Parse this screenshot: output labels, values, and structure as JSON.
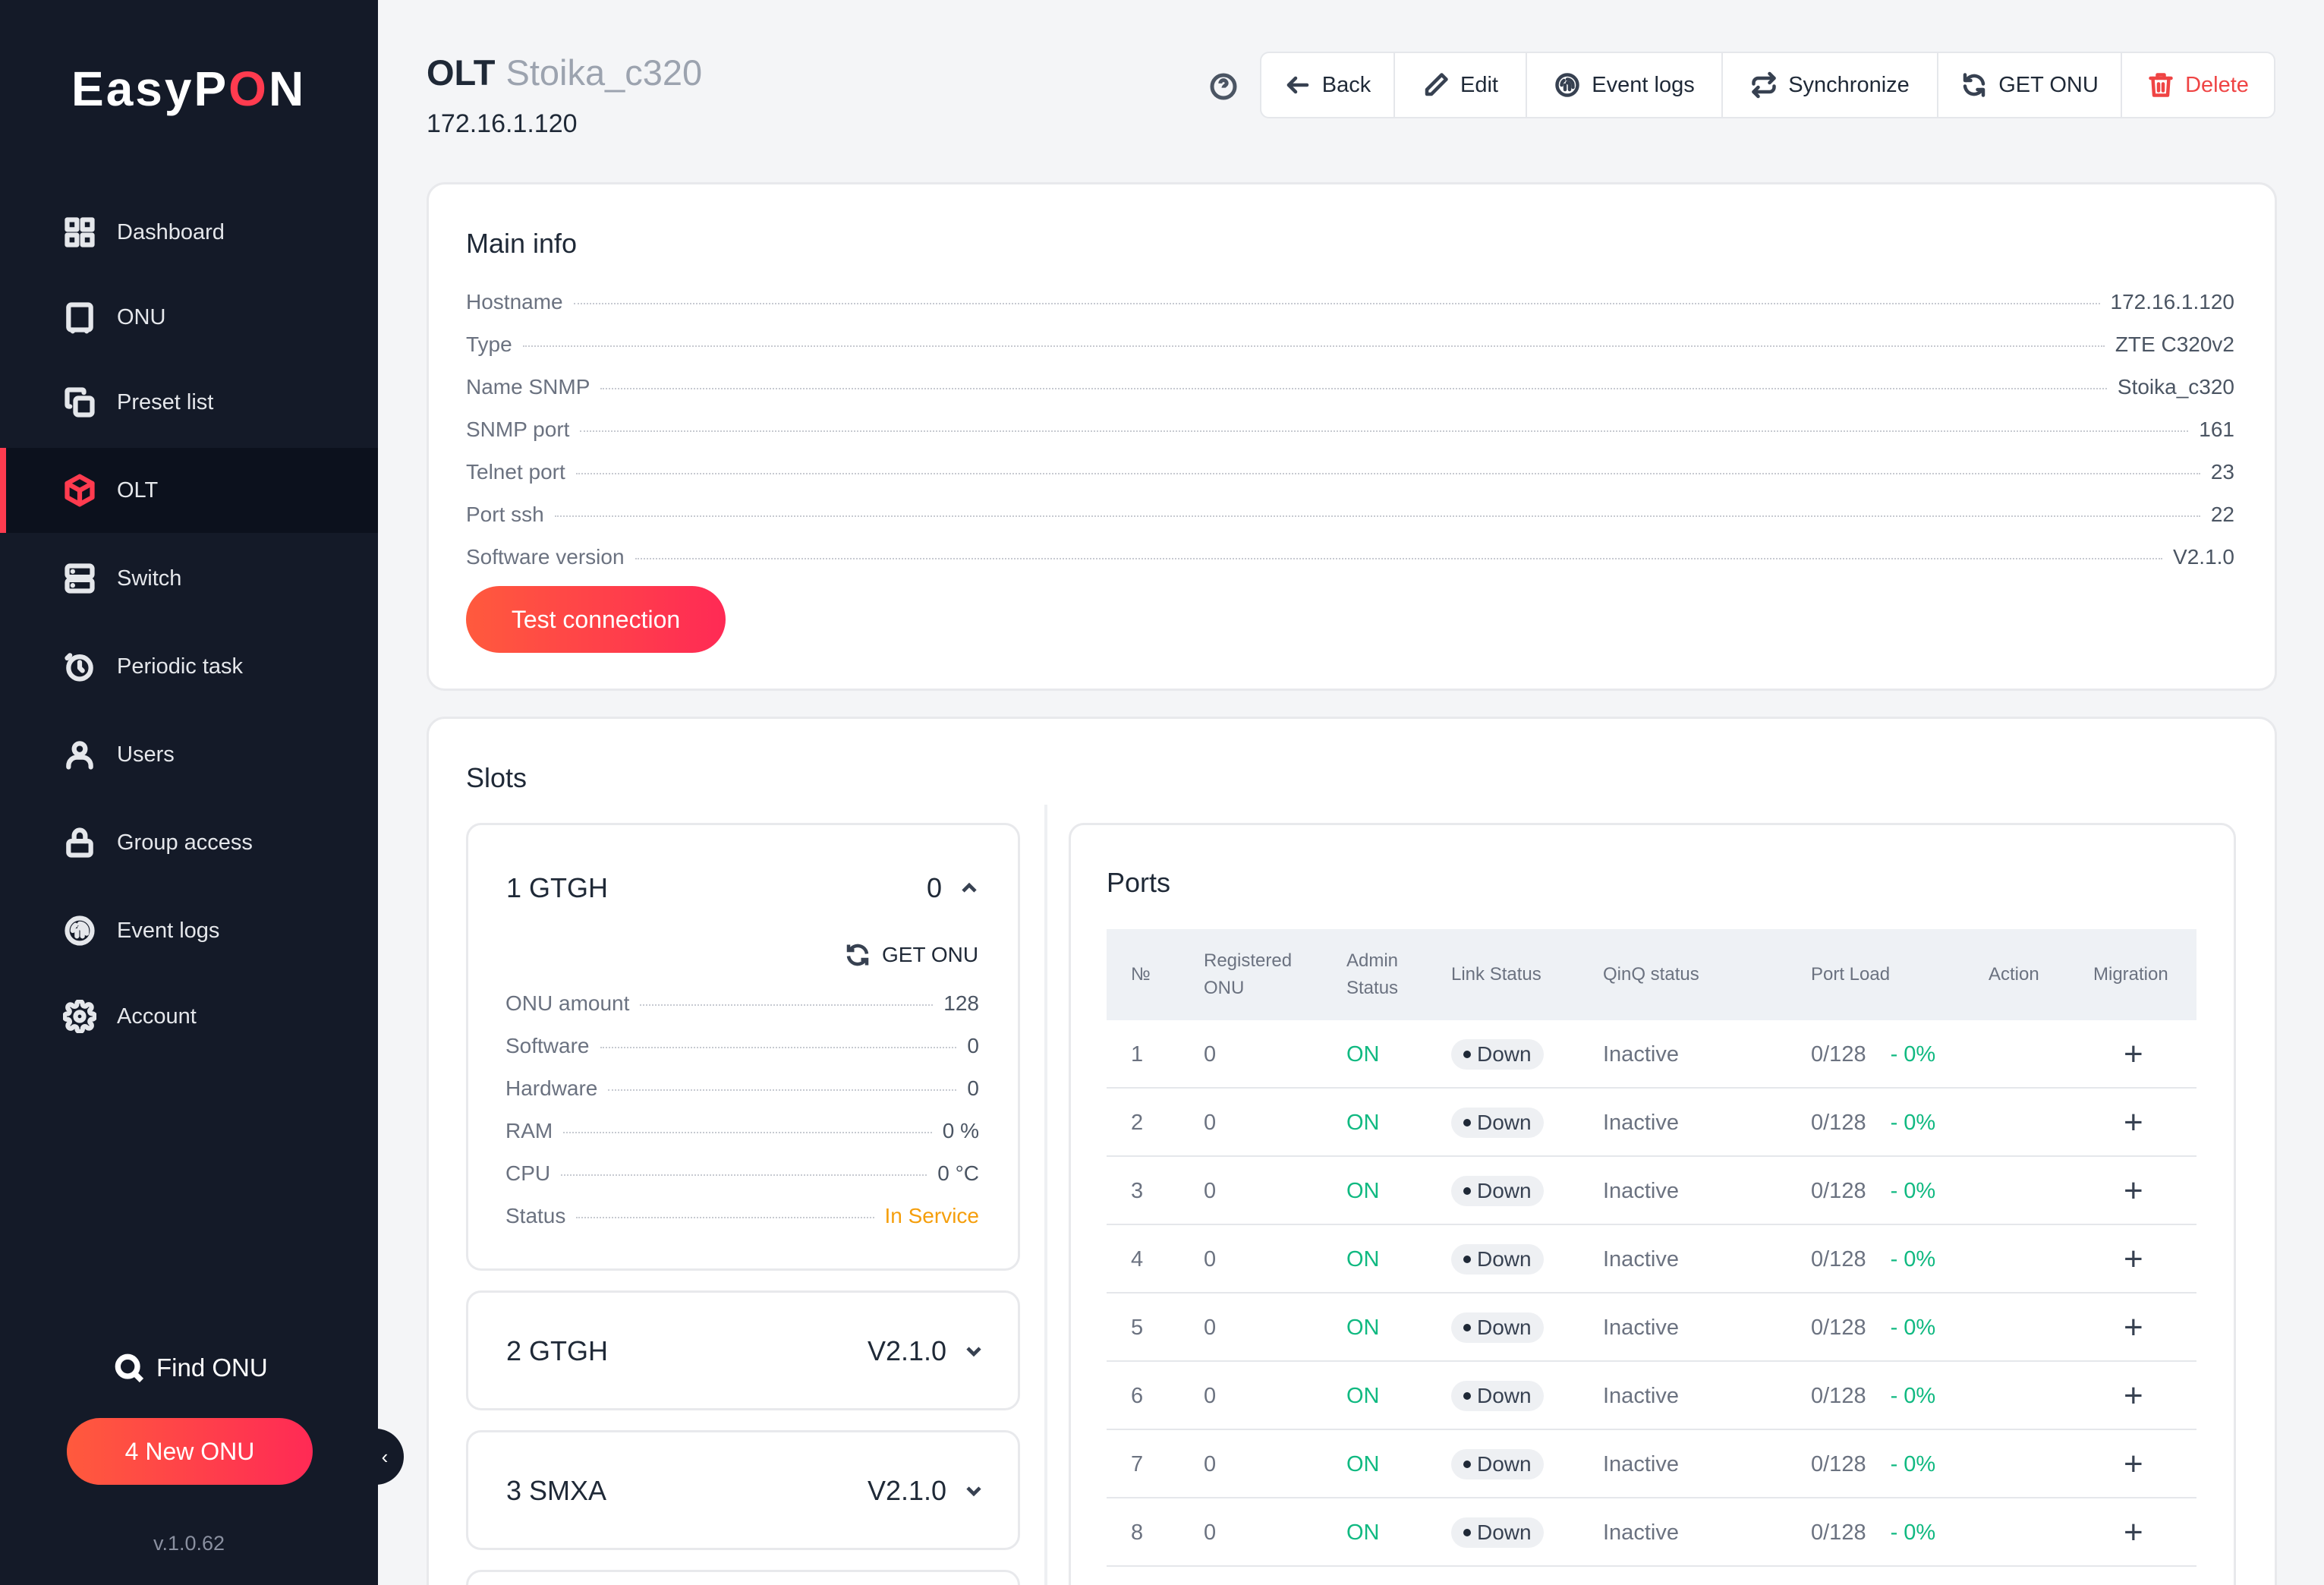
{
  "app": {
    "logo_pre": "EasyP",
    "logo_o": "O",
    "logo_post": "N",
    "version": "v.1.0.62",
    "find_onu": "Find ONU",
    "new_onu": "4 New ONU"
  },
  "sidebar": {
    "items": [
      {
        "label": "Dashboard",
        "icon": "dashboard-icon"
      },
      {
        "label": "ONU",
        "icon": "onu-icon"
      },
      {
        "label": "Preset list",
        "icon": "copy-icon"
      },
      {
        "label": "OLT",
        "icon": "cube-icon",
        "active": true
      },
      {
        "label": "Switch",
        "icon": "server-icon"
      },
      {
        "label": "Periodic task",
        "icon": "timer-icon"
      },
      {
        "label": "Users",
        "icon": "user-icon"
      },
      {
        "label": "Group access",
        "icon": "lock-icon"
      },
      {
        "label": "Event logs",
        "icon": "fingerprint-icon"
      },
      {
        "label": "Account",
        "icon": "gear-icon"
      }
    ]
  },
  "header": {
    "title": "OLT",
    "subtitle": "Stoika_c320",
    "ip": "172.16.1.120"
  },
  "toolbar": {
    "back": "Back",
    "edit": "Edit",
    "event_logs": "Event logs",
    "synchronize": "Synchronize",
    "get_onu": "GET ONU",
    "delete": "Delete"
  },
  "main_info": {
    "title": "Main info",
    "rows": [
      {
        "k": "Hostname",
        "v": "172.16.1.120"
      },
      {
        "k": "Type",
        "v": "ZTE C320v2"
      },
      {
        "k": "Name SNMP",
        "v": "Stoika_c320"
      },
      {
        "k": "SNMP port",
        "v": "161"
      },
      {
        "k": "Telnet port",
        "v": "23"
      },
      {
        "k": "Port ssh",
        "v": "22"
      },
      {
        "k": "Software version",
        "v": "V2.1.0"
      }
    ],
    "test_button": "Test connection"
  },
  "slots": {
    "title": "Slots",
    "expanded": {
      "name": "1 GTGH",
      "count": "0",
      "get_onu": "GET ONU",
      "rows": [
        {
          "k": "ONU amount",
          "v": "128"
        },
        {
          "k": "Software",
          "v": "0"
        },
        {
          "k": "Hardware",
          "v": "0"
        },
        {
          "k": "RAM",
          "v": "0 %"
        },
        {
          "k": "CPU",
          "v": "0 °C"
        },
        {
          "k": "Status",
          "v": "In Service"
        }
      ]
    },
    "collapsed": [
      {
        "name": "2 GTGH",
        "version": "V2.1.0"
      },
      {
        "name": "3 SMXA",
        "version": "V2.1.0"
      }
    ]
  },
  "ports": {
    "title": "Ports",
    "headers": {
      "num": "№",
      "registered_1": "Registered",
      "registered_2": "ONU",
      "admin_1": "Admin",
      "admin_2": "Status",
      "link": "Link Status",
      "qinq": "QinQ status",
      "load": "Port Load",
      "action": "Action",
      "migration": "Migration"
    },
    "rows": [
      {
        "num": "1",
        "reg": "0",
        "admin": "ON",
        "link": "Down",
        "qinq": "Inactive",
        "load": "0/128",
        "pct": "- 0%",
        "mig": "+"
      },
      {
        "num": "2",
        "reg": "0",
        "admin": "ON",
        "link": "Down",
        "qinq": "Inactive",
        "load": "0/128",
        "pct": "- 0%",
        "mig": "+"
      },
      {
        "num": "3",
        "reg": "0",
        "admin": "ON",
        "link": "Down",
        "qinq": "Inactive",
        "load": "0/128",
        "pct": "- 0%",
        "mig": "+"
      },
      {
        "num": "4",
        "reg": "0",
        "admin": "ON",
        "link": "Down",
        "qinq": "Inactive",
        "load": "0/128",
        "pct": "- 0%",
        "mig": "+"
      },
      {
        "num": "5",
        "reg": "0",
        "admin": "ON",
        "link": "Down",
        "qinq": "Inactive",
        "load": "0/128",
        "pct": "- 0%",
        "mig": "+"
      },
      {
        "num": "6",
        "reg": "0",
        "admin": "ON",
        "link": "Down",
        "qinq": "Inactive",
        "load": "0/128",
        "pct": "- 0%",
        "mig": "+"
      },
      {
        "num": "7",
        "reg": "0",
        "admin": "ON",
        "link": "Down",
        "qinq": "Inactive",
        "load": "0/128",
        "pct": "- 0%",
        "mig": "+"
      },
      {
        "num": "8",
        "reg": "0",
        "admin": "ON",
        "link": "Down",
        "qinq": "Inactive",
        "load": "0/128",
        "pct": "- 0%",
        "mig": "+"
      }
    ]
  },
  "colors": {
    "accent": "#ff3b4f",
    "sidebar_bg": "#141a28",
    "on_green": "#10b981",
    "in_service": "#f59e0b",
    "delete_red": "#ef4444"
  }
}
